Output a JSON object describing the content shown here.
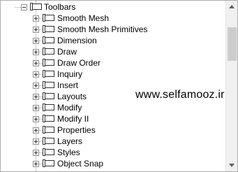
{
  "tree": {
    "parent": {
      "label": "Toolbars",
      "icon": "toolbar-icon",
      "expanded": true
    },
    "items": [
      {
        "label": "Smooth Mesh"
      },
      {
        "label": "Smooth Mesh Primitives"
      },
      {
        "label": "Dimension"
      },
      {
        "label": "Draw"
      },
      {
        "label": "Draw Order"
      },
      {
        "label": "Inquiry"
      },
      {
        "label": "Insert"
      },
      {
        "label": "Layouts"
      },
      {
        "label": "Modify"
      },
      {
        "label": "Modify II"
      },
      {
        "label": "Properties"
      },
      {
        "label": "Layers"
      },
      {
        "label": "Styles"
      },
      {
        "label": "Object Snap"
      }
    ]
  },
  "watermark": {
    "text": "www.selfamooz.ir"
  },
  "colors": {
    "tree_line": "#a0a0a0",
    "scrollbar_track": "#f0f0f0",
    "scrollbar_thumb": "#cdcdcd",
    "border": "#acacac"
  }
}
